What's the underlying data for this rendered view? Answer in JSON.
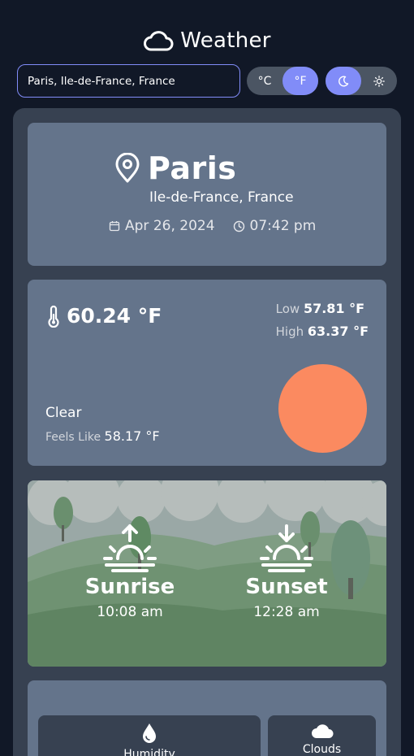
{
  "header": {
    "title": "Weather",
    "icon": "cloud-icon"
  },
  "search": {
    "value": "Paris, Ile-de-France, France"
  },
  "units": {
    "celsius": "°C",
    "fahrenheit": "°F",
    "active": "fahrenheit"
  },
  "theme": {
    "active": "dark",
    "icons": [
      "moon-icon",
      "sun-icon"
    ]
  },
  "location": {
    "city": "Paris",
    "region": "Ile-de-France, France",
    "date": "Apr 26, 2024",
    "time": "07:42 pm"
  },
  "weather": {
    "temp": "60.24 °F",
    "low_label": "Low",
    "low": "57.81 °F",
    "high_label": "High",
    "high": "63.37 °F",
    "condition": "Clear",
    "feels_like_label": "Feels Like",
    "feels_like": "58.17 °F"
  },
  "sun": {
    "sunrise_label": "Sunrise",
    "sunrise": "10:08 am",
    "sunset_label": "Sunset",
    "sunset": "12:28 am"
  },
  "stats": {
    "humidity_label": "Humidity",
    "clouds_label": "Clouds"
  },
  "colors": {
    "background": "#111827",
    "panel": "#374151",
    "card": "#64748b",
    "accent": "#818cf8",
    "sun": "#fb8a60"
  }
}
